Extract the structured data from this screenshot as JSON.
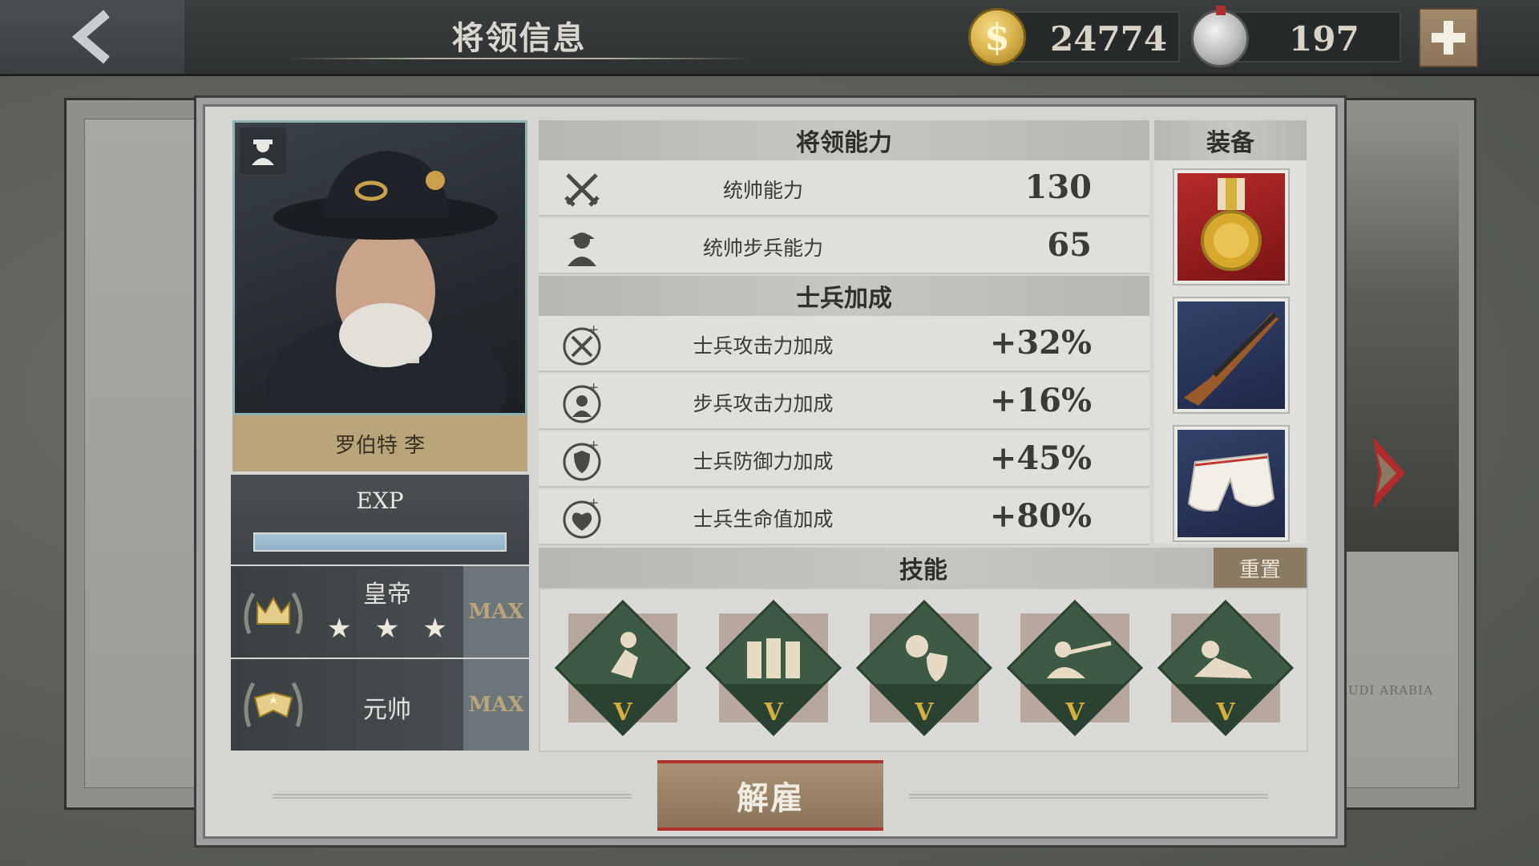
{
  "header": {
    "title": "将领信息",
    "gold": "24774",
    "medals": "197"
  },
  "general": {
    "name": "罗伯特 李",
    "exp_label": "EXP",
    "exp_progress": 1.0
  },
  "ranks": [
    {
      "name": "皇帝",
      "max_label": "MAX",
      "stars": 3
    },
    {
      "name": "元帅",
      "max_label": "MAX"
    }
  ],
  "abilities": {
    "heading": "将领能力",
    "rows": [
      {
        "label": "统帅能力",
        "value": "130",
        "icon": "crossed-swords-icon"
      },
      {
        "label": "统帅步兵能力",
        "value": "65",
        "icon": "infantry-soldier-icon"
      }
    ]
  },
  "bonuses": {
    "heading": "士兵加成",
    "rows": [
      {
        "label": "士兵攻击力加成",
        "value": "+32%",
        "icon": "attack-plus-icon"
      },
      {
        "label": "步兵攻击力加成",
        "value": "+16%",
        "icon": "infantry-plus-icon"
      },
      {
        "label": "士兵防御力加成",
        "value": "+45%",
        "icon": "shield-plus-icon"
      },
      {
        "label": "士兵生命值加成",
        "value": "+80%",
        "icon": "heart-plus-icon"
      }
    ]
  },
  "equipment": {
    "heading": "装备",
    "items": [
      "medal-icon",
      "rifle-icon",
      "pants-icon"
    ]
  },
  "skills": {
    "heading": "技能",
    "reset_label": "重置",
    "items": [
      {
        "icon": "running-soldier-icon",
        "level": "V"
      },
      {
        "icon": "marching-troops-icon",
        "level": "V"
      },
      {
        "icon": "shield-soldier-icon",
        "level": "V"
      },
      {
        "icon": "sniper-soldier-icon",
        "level": "V"
      },
      {
        "icon": "crawling-soldier-icon",
        "level": "V"
      }
    ]
  },
  "actions": {
    "dismiss_label": "解雇"
  },
  "map": {
    "label": "AUDI ARABIA"
  },
  "colors": {
    "panel_bg": "#d5d6d1",
    "accent_gold": "#b8a57b",
    "skill_green": "#3d5a45",
    "dismiss_red": "#b0322c"
  }
}
